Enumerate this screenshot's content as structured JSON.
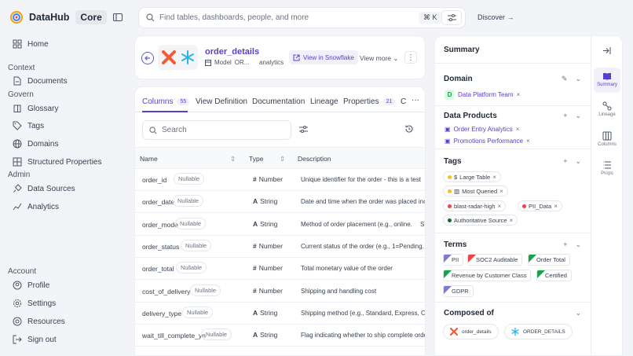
{
  "brand": {
    "name": "DataHub",
    "edition": "Core"
  },
  "nav": {
    "home": "Home",
    "context_label": "Context",
    "documents": "Documents",
    "govern_label": "Govern",
    "glossary": "Glossary",
    "tags": "Tags",
    "domains": "Domains",
    "structured_properties": "Structured Properties",
    "admin_label": "Admin",
    "data_sources": "Data Sources",
    "analytics": "Analytics",
    "account_label": "Account",
    "profile": "Profile",
    "settings": "Settings",
    "resources": "Resources",
    "sign_out": "Sign out"
  },
  "search": {
    "placeholder": "Find tables, dashboards, people, and more",
    "shortcut": "⌘ K"
  },
  "discover": "Discover →",
  "entity": {
    "name": "order_details",
    "type": "Model",
    "platform_short": "OR...",
    "container": "analytics",
    "view_in": "View in Snowflake",
    "view_more": "View more"
  },
  "tabs": [
    {
      "label": "Columns",
      "count": "55"
    },
    {
      "label": "View Definition"
    },
    {
      "label": "Documentation"
    },
    {
      "label": "Lineage"
    },
    {
      "label": "Properties",
      "count": "21"
    },
    {
      "label": "C"
    }
  ],
  "table": {
    "search_placeholder": "Search",
    "headers": {
      "name": "Name",
      "type": "Type",
      "description": "Description"
    },
    "nullable_label": "Nullable",
    "rows": [
      {
        "name": "order_id",
        "type": "Number",
        "desc": "Unique identifier for the order - this is a test"
      },
      {
        "name": "order_date",
        "type": "String",
        "desc": "Date and time when the order was placed incl"
      },
      {
        "name": "order_mode",
        "type": "String",
        "desc": "Method of order placement (e.g., online.",
        "extra": "Sh"
      },
      {
        "name": "order_status",
        "type": "Number",
        "desc": "Current status of the order (e.g., 1=Pending."
      },
      {
        "name": "order_total",
        "type": "Number",
        "desc": "Total monetary value of the order"
      },
      {
        "name": "cost_of_delivery",
        "type": "Number",
        "desc": "Shipping and handling cost"
      },
      {
        "name": "delivery_type",
        "type": "String",
        "desc": "Shipping method (e.g., Standard, Express, Ove"
      },
      {
        "name": "wait_till_complete_yn",
        "type": "String",
        "desc": "Flag indicating whether to ship complete orde"
      }
    ]
  },
  "summary": {
    "title": "Summary",
    "domain": {
      "label": "Domain",
      "letter": "D",
      "value": "Data Platform Team"
    },
    "data_products": {
      "label": "Data Products",
      "items": [
        "Order Entry Analytics",
        "Promotions Performance"
      ]
    },
    "tags": {
      "label": "Tags",
      "items": [
        "Large Table",
        "Most Queried",
        "blast-radar-high",
        "PII_Data",
        "Authoritative Source"
      ]
    },
    "terms": {
      "label": "Terms",
      "items": [
        "PII",
        "SOC2 Auditable",
        "Order Total",
        "Revenue by Customer Class",
        "Certified",
        "GDPR"
      ]
    },
    "composed_of": {
      "label": "Composed of",
      "items": [
        "order_details",
        "ORDER_DETAILS"
      ]
    }
  },
  "rail": [
    "Summary",
    "Lineage",
    "Columns",
    "Props"
  ],
  "colors": {
    "accent": "#5b3ec8",
    "domain_badge": "#16a34a"
  }
}
